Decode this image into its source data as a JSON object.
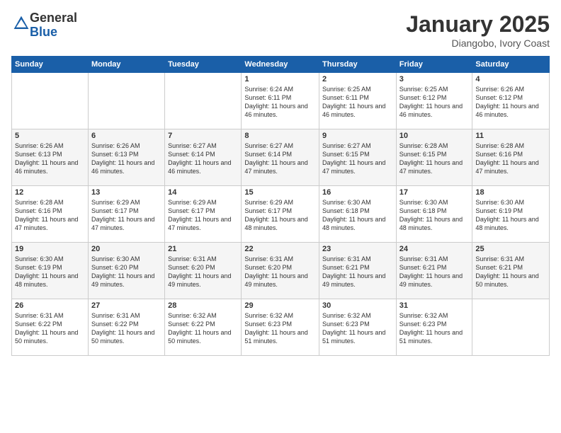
{
  "logo": {
    "general": "General",
    "blue": "Blue"
  },
  "header": {
    "title": "January 2025",
    "location": "Diangobo, Ivory Coast"
  },
  "weekdays": [
    "Sunday",
    "Monday",
    "Tuesday",
    "Wednesday",
    "Thursday",
    "Friday",
    "Saturday"
  ],
  "weeks": [
    [
      {
        "day": "",
        "sunrise": "",
        "sunset": "",
        "daylight": ""
      },
      {
        "day": "",
        "sunrise": "",
        "sunset": "",
        "daylight": ""
      },
      {
        "day": "",
        "sunrise": "",
        "sunset": "",
        "daylight": ""
      },
      {
        "day": "1",
        "sunrise": "Sunrise: 6:24 AM",
        "sunset": "Sunset: 6:11 PM",
        "daylight": "Daylight: 11 hours and 46 minutes."
      },
      {
        "day": "2",
        "sunrise": "Sunrise: 6:25 AM",
        "sunset": "Sunset: 6:11 PM",
        "daylight": "Daylight: 11 hours and 46 minutes."
      },
      {
        "day": "3",
        "sunrise": "Sunrise: 6:25 AM",
        "sunset": "Sunset: 6:12 PM",
        "daylight": "Daylight: 11 hours and 46 minutes."
      },
      {
        "day": "4",
        "sunrise": "Sunrise: 6:26 AM",
        "sunset": "Sunset: 6:12 PM",
        "daylight": "Daylight: 11 hours and 46 minutes."
      }
    ],
    [
      {
        "day": "5",
        "sunrise": "Sunrise: 6:26 AM",
        "sunset": "Sunset: 6:13 PM",
        "daylight": "Daylight: 11 hours and 46 minutes."
      },
      {
        "day": "6",
        "sunrise": "Sunrise: 6:26 AM",
        "sunset": "Sunset: 6:13 PM",
        "daylight": "Daylight: 11 hours and 46 minutes."
      },
      {
        "day": "7",
        "sunrise": "Sunrise: 6:27 AM",
        "sunset": "Sunset: 6:14 PM",
        "daylight": "Daylight: 11 hours and 46 minutes."
      },
      {
        "day": "8",
        "sunrise": "Sunrise: 6:27 AM",
        "sunset": "Sunset: 6:14 PM",
        "daylight": "Daylight: 11 hours and 47 minutes."
      },
      {
        "day": "9",
        "sunrise": "Sunrise: 6:27 AM",
        "sunset": "Sunset: 6:15 PM",
        "daylight": "Daylight: 11 hours and 47 minutes."
      },
      {
        "day": "10",
        "sunrise": "Sunrise: 6:28 AM",
        "sunset": "Sunset: 6:15 PM",
        "daylight": "Daylight: 11 hours and 47 minutes."
      },
      {
        "day": "11",
        "sunrise": "Sunrise: 6:28 AM",
        "sunset": "Sunset: 6:16 PM",
        "daylight": "Daylight: 11 hours and 47 minutes."
      }
    ],
    [
      {
        "day": "12",
        "sunrise": "Sunrise: 6:28 AM",
        "sunset": "Sunset: 6:16 PM",
        "daylight": "Daylight: 11 hours and 47 minutes."
      },
      {
        "day": "13",
        "sunrise": "Sunrise: 6:29 AM",
        "sunset": "Sunset: 6:17 PM",
        "daylight": "Daylight: 11 hours and 47 minutes."
      },
      {
        "day": "14",
        "sunrise": "Sunrise: 6:29 AM",
        "sunset": "Sunset: 6:17 PM",
        "daylight": "Daylight: 11 hours and 47 minutes."
      },
      {
        "day": "15",
        "sunrise": "Sunrise: 6:29 AM",
        "sunset": "Sunset: 6:17 PM",
        "daylight": "Daylight: 11 hours and 48 minutes."
      },
      {
        "day": "16",
        "sunrise": "Sunrise: 6:30 AM",
        "sunset": "Sunset: 6:18 PM",
        "daylight": "Daylight: 11 hours and 48 minutes."
      },
      {
        "day": "17",
        "sunrise": "Sunrise: 6:30 AM",
        "sunset": "Sunset: 6:18 PM",
        "daylight": "Daylight: 11 hours and 48 minutes."
      },
      {
        "day": "18",
        "sunrise": "Sunrise: 6:30 AM",
        "sunset": "Sunset: 6:19 PM",
        "daylight": "Daylight: 11 hours and 48 minutes."
      }
    ],
    [
      {
        "day": "19",
        "sunrise": "Sunrise: 6:30 AM",
        "sunset": "Sunset: 6:19 PM",
        "daylight": "Daylight: 11 hours and 48 minutes."
      },
      {
        "day": "20",
        "sunrise": "Sunrise: 6:30 AM",
        "sunset": "Sunset: 6:20 PM",
        "daylight": "Daylight: 11 hours and 49 minutes."
      },
      {
        "day": "21",
        "sunrise": "Sunrise: 6:31 AM",
        "sunset": "Sunset: 6:20 PM",
        "daylight": "Daylight: 11 hours and 49 minutes."
      },
      {
        "day": "22",
        "sunrise": "Sunrise: 6:31 AM",
        "sunset": "Sunset: 6:20 PM",
        "daylight": "Daylight: 11 hours and 49 minutes."
      },
      {
        "day": "23",
        "sunrise": "Sunrise: 6:31 AM",
        "sunset": "Sunset: 6:21 PM",
        "daylight": "Daylight: 11 hours and 49 minutes."
      },
      {
        "day": "24",
        "sunrise": "Sunrise: 6:31 AM",
        "sunset": "Sunset: 6:21 PM",
        "daylight": "Daylight: 11 hours and 49 minutes."
      },
      {
        "day": "25",
        "sunrise": "Sunrise: 6:31 AM",
        "sunset": "Sunset: 6:21 PM",
        "daylight": "Daylight: 11 hours and 50 minutes."
      }
    ],
    [
      {
        "day": "26",
        "sunrise": "Sunrise: 6:31 AM",
        "sunset": "Sunset: 6:22 PM",
        "daylight": "Daylight: 11 hours and 50 minutes."
      },
      {
        "day": "27",
        "sunrise": "Sunrise: 6:31 AM",
        "sunset": "Sunset: 6:22 PM",
        "daylight": "Daylight: 11 hours and 50 minutes."
      },
      {
        "day": "28",
        "sunrise": "Sunrise: 6:32 AM",
        "sunset": "Sunset: 6:22 PM",
        "daylight": "Daylight: 11 hours and 50 minutes."
      },
      {
        "day": "29",
        "sunrise": "Sunrise: 6:32 AM",
        "sunset": "Sunset: 6:23 PM",
        "daylight": "Daylight: 11 hours and 51 minutes."
      },
      {
        "day": "30",
        "sunrise": "Sunrise: 6:32 AM",
        "sunset": "Sunset: 6:23 PM",
        "daylight": "Daylight: 11 hours and 51 minutes."
      },
      {
        "day": "31",
        "sunrise": "Sunrise: 6:32 AM",
        "sunset": "Sunset: 6:23 PM",
        "daylight": "Daylight: 11 hours and 51 minutes."
      },
      {
        "day": "",
        "sunrise": "",
        "sunset": "",
        "daylight": ""
      }
    ]
  ]
}
